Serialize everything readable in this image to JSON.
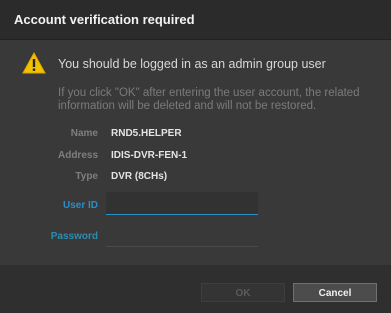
{
  "dialog": {
    "title": "Account verification required",
    "warning_message": "You should be logged in as an admin group user",
    "info_text": "If you click \"OK\" after entering the user account, the related information will be deleted and will not be restored."
  },
  "device": {
    "name_label": "Name",
    "name_value": "RND5.HELPER",
    "address_label": "Address",
    "address_value": "IDIS-DVR-FEN-1",
    "type_label": "Type",
    "type_value": "DVR (8CHs)"
  },
  "form": {
    "userid_label": "User ID",
    "userid_value": "",
    "password_label": "Password",
    "password_value": ""
  },
  "buttons": {
    "ok_label": "OK",
    "cancel_label": "Cancel"
  },
  "icons": {
    "warning": "warning-triangle-icon"
  },
  "colors": {
    "accent": "#2a8fc9",
    "warning_yellow": "#f2c200"
  }
}
